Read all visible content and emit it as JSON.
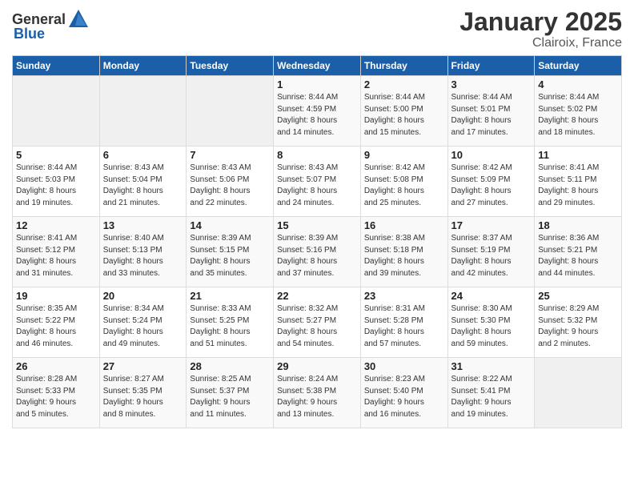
{
  "header": {
    "logo_general": "General",
    "logo_blue": "Blue",
    "month": "January 2025",
    "location": "Clairoix, France"
  },
  "days_of_week": [
    "Sunday",
    "Monday",
    "Tuesday",
    "Wednesday",
    "Thursday",
    "Friday",
    "Saturday"
  ],
  "weeks": [
    [
      {
        "day": "",
        "info": ""
      },
      {
        "day": "",
        "info": ""
      },
      {
        "day": "",
        "info": ""
      },
      {
        "day": "1",
        "info": "Sunrise: 8:44 AM\nSunset: 4:59 PM\nDaylight: 8 hours\nand 14 minutes."
      },
      {
        "day": "2",
        "info": "Sunrise: 8:44 AM\nSunset: 5:00 PM\nDaylight: 8 hours\nand 15 minutes."
      },
      {
        "day": "3",
        "info": "Sunrise: 8:44 AM\nSunset: 5:01 PM\nDaylight: 8 hours\nand 17 minutes."
      },
      {
        "day": "4",
        "info": "Sunrise: 8:44 AM\nSunset: 5:02 PM\nDaylight: 8 hours\nand 18 minutes."
      }
    ],
    [
      {
        "day": "5",
        "info": "Sunrise: 8:44 AM\nSunset: 5:03 PM\nDaylight: 8 hours\nand 19 minutes."
      },
      {
        "day": "6",
        "info": "Sunrise: 8:43 AM\nSunset: 5:04 PM\nDaylight: 8 hours\nand 21 minutes."
      },
      {
        "day": "7",
        "info": "Sunrise: 8:43 AM\nSunset: 5:06 PM\nDaylight: 8 hours\nand 22 minutes."
      },
      {
        "day": "8",
        "info": "Sunrise: 8:43 AM\nSunset: 5:07 PM\nDaylight: 8 hours\nand 24 minutes."
      },
      {
        "day": "9",
        "info": "Sunrise: 8:42 AM\nSunset: 5:08 PM\nDaylight: 8 hours\nand 25 minutes."
      },
      {
        "day": "10",
        "info": "Sunrise: 8:42 AM\nSunset: 5:09 PM\nDaylight: 8 hours\nand 27 minutes."
      },
      {
        "day": "11",
        "info": "Sunrise: 8:41 AM\nSunset: 5:11 PM\nDaylight: 8 hours\nand 29 minutes."
      }
    ],
    [
      {
        "day": "12",
        "info": "Sunrise: 8:41 AM\nSunset: 5:12 PM\nDaylight: 8 hours\nand 31 minutes."
      },
      {
        "day": "13",
        "info": "Sunrise: 8:40 AM\nSunset: 5:13 PM\nDaylight: 8 hours\nand 33 minutes."
      },
      {
        "day": "14",
        "info": "Sunrise: 8:39 AM\nSunset: 5:15 PM\nDaylight: 8 hours\nand 35 minutes."
      },
      {
        "day": "15",
        "info": "Sunrise: 8:39 AM\nSunset: 5:16 PM\nDaylight: 8 hours\nand 37 minutes."
      },
      {
        "day": "16",
        "info": "Sunrise: 8:38 AM\nSunset: 5:18 PM\nDaylight: 8 hours\nand 39 minutes."
      },
      {
        "day": "17",
        "info": "Sunrise: 8:37 AM\nSunset: 5:19 PM\nDaylight: 8 hours\nand 42 minutes."
      },
      {
        "day": "18",
        "info": "Sunrise: 8:36 AM\nSunset: 5:21 PM\nDaylight: 8 hours\nand 44 minutes."
      }
    ],
    [
      {
        "day": "19",
        "info": "Sunrise: 8:35 AM\nSunset: 5:22 PM\nDaylight: 8 hours\nand 46 minutes."
      },
      {
        "day": "20",
        "info": "Sunrise: 8:34 AM\nSunset: 5:24 PM\nDaylight: 8 hours\nand 49 minutes."
      },
      {
        "day": "21",
        "info": "Sunrise: 8:33 AM\nSunset: 5:25 PM\nDaylight: 8 hours\nand 51 minutes."
      },
      {
        "day": "22",
        "info": "Sunrise: 8:32 AM\nSunset: 5:27 PM\nDaylight: 8 hours\nand 54 minutes."
      },
      {
        "day": "23",
        "info": "Sunrise: 8:31 AM\nSunset: 5:28 PM\nDaylight: 8 hours\nand 57 minutes."
      },
      {
        "day": "24",
        "info": "Sunrise: 8:30 AM\nSunset: 5:30 PM\nDaylight: 8 hours\nand 59 minutes."
      },
      {
        "day": "25",
        "info": "Sunrise: 8:29 AM\nSunset: 5:32 PM\nDaylight: 9 hours\nand 2 minutes."
      }
    ],
    [
      {
        "day": "26",
        "info": "Sunrise: 8:28 AM\nSunset: 5:33 PM\nDaylight: 9 hours\nand 5 minutes."
      },
      {
        "day": "27",
        "info": "Sunrise: 8:27 AM\nSunset: 5:35 PM\nDaylight: 9 hours\nand 8 minutes."
      },
      {
        "day": "28",
        "info": "Sunrise: 8:25 AM\nSunset: 5:37 PM\nDaylight: 9 hours\nand 11 minutes."
      },
      {
        "day": "29",
        "info": "Sunrise: 8:24 AM\nSunset: 5:38 PM\nDaylight: 9 hours\nand 13 minutes."
      },
      {
        "day": "30",
        "info": "Sunrise: 8:23 AM\nSunset: 5:40 PM\nDaylight: 9 hours\nand 16 minutes."
      },
      {
        "day": "31",
        "info": "Sunrise: 8:22 AM\nSunset: 5:41 PM\nDaylight: 9 hours\nand 19 minutes."
      },
      {
        "day": "",
        "info": ""
      }
    ]
  ]
}
